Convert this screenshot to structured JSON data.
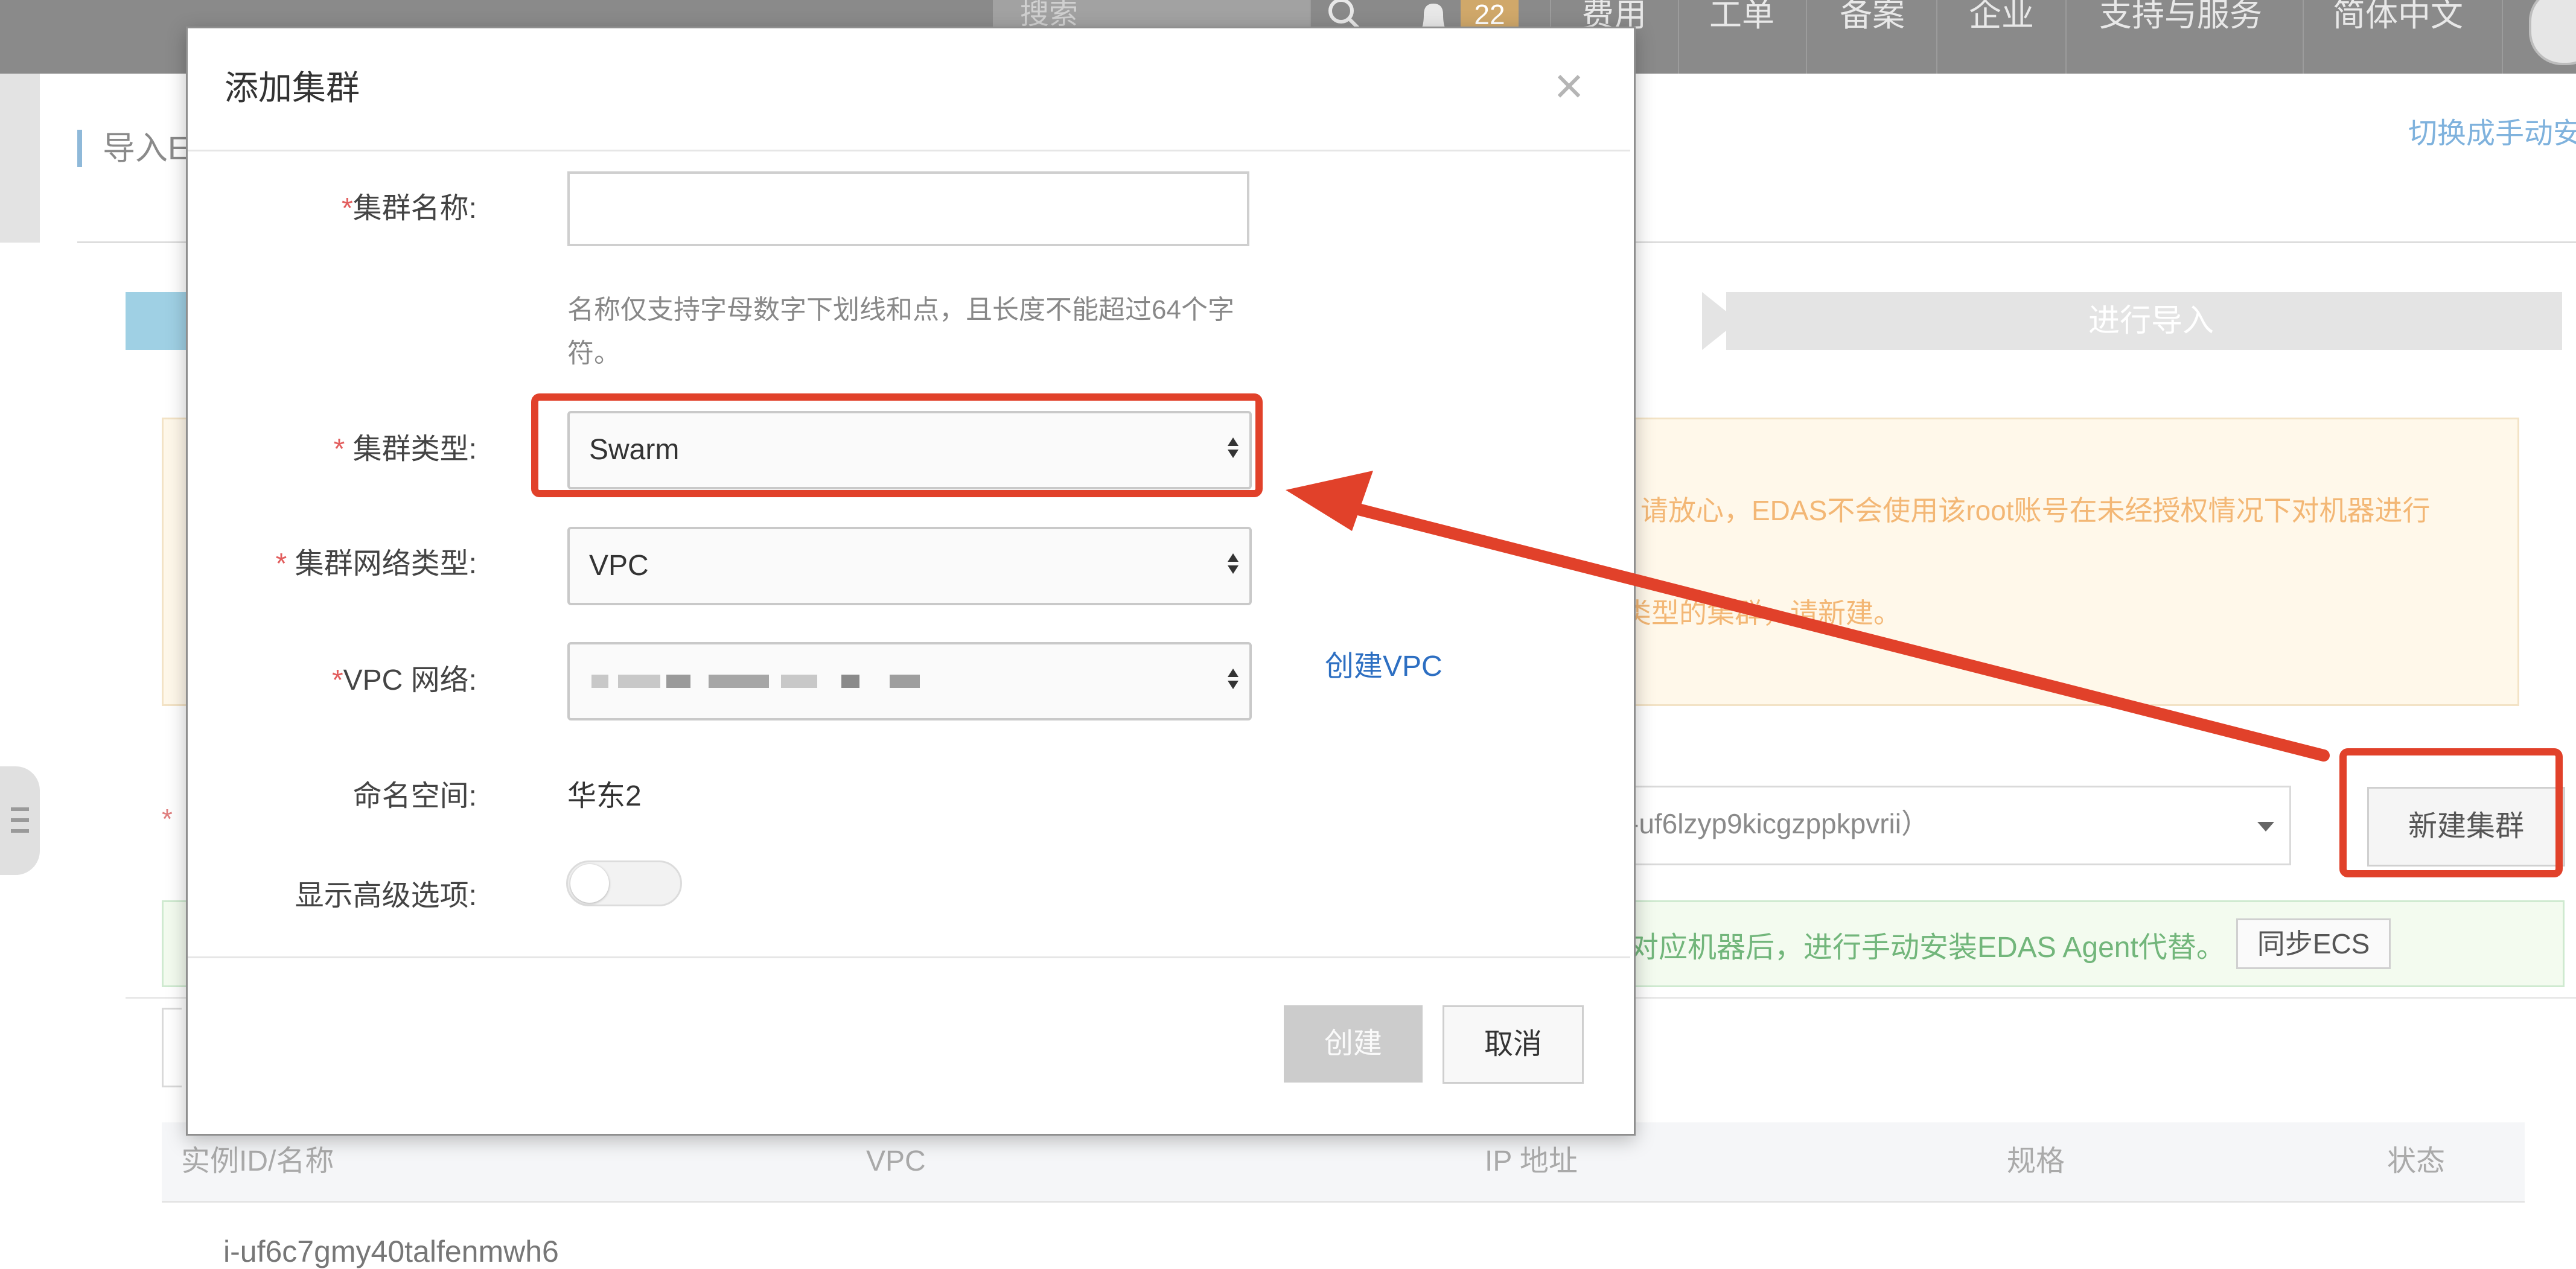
{
  "topnav": {
    "search_placeholder": "搜索",
    "notification_count": "22",
    "items": [
      "费用",
      "工单",
      "备案",
      "企业",
      "支持与服务",
      "简体中文"
    ]
  },
  "background": {
    "breadcrumb": "导入E",
    "switch_link": "切换成手动安",
    "step_label": "进行导入",
    "warn_line1": "请放心，EDAS不会使用该root账号在未经授权情况下对机器进行",
    "warn_line2": "类型的集群，请新建。",
    "namespace_select_text": "-uf6lzyp9kicgzppkpvrii）",
    "new_cluster_button": "新建集群",
    "green_tip": "对应机器后，进行手动安装EDAS Agent代替。",
    "sync_button": "同步ECS",
    "table_headers": [
      "实例ID/名称",
      "VPC",
      "IP 地址",
      "规格",
      "状态"
    ],
    "table_first_row": "i-uf6c7gmy40talfenmwh6"
  },
  "modal": {
    "title": "添加集群",
    "close_symbol": "×",
    "fields": {
      "cluster_name": {
        "label": "集群名称:",
        "value": "",
        "help": "名称仅支持字母数字下划线和点，且长度不能超过64个字符。"
      },
      "cluster_type": {
        "label": "集群类型:",
        "selected": "Swarm"
      },
      "network_type": {
        "label": "集群网络类型:",
        "selected": "VPC"
      },
      "vpc": {
        "label": "VPC 网络:",
        "create_link": "创建VPC"
      },
      "namespace": {
        "label": "命名空间:",
        "value": "华东2"
      },
      "advanced": {
        "label": "显示高级选项:",
        "enabled": false
      }
    },
    "buttons": {
      "create": "创建",
      "cancel": "取消"
    }
  },
  "annotation_color": "#e1412a",
  "icons": [
    "search-icon",
    "bell-icon",
    "close-icon",
    "select-updown-icon",
    "menu-tab-icon"
  ]
}
